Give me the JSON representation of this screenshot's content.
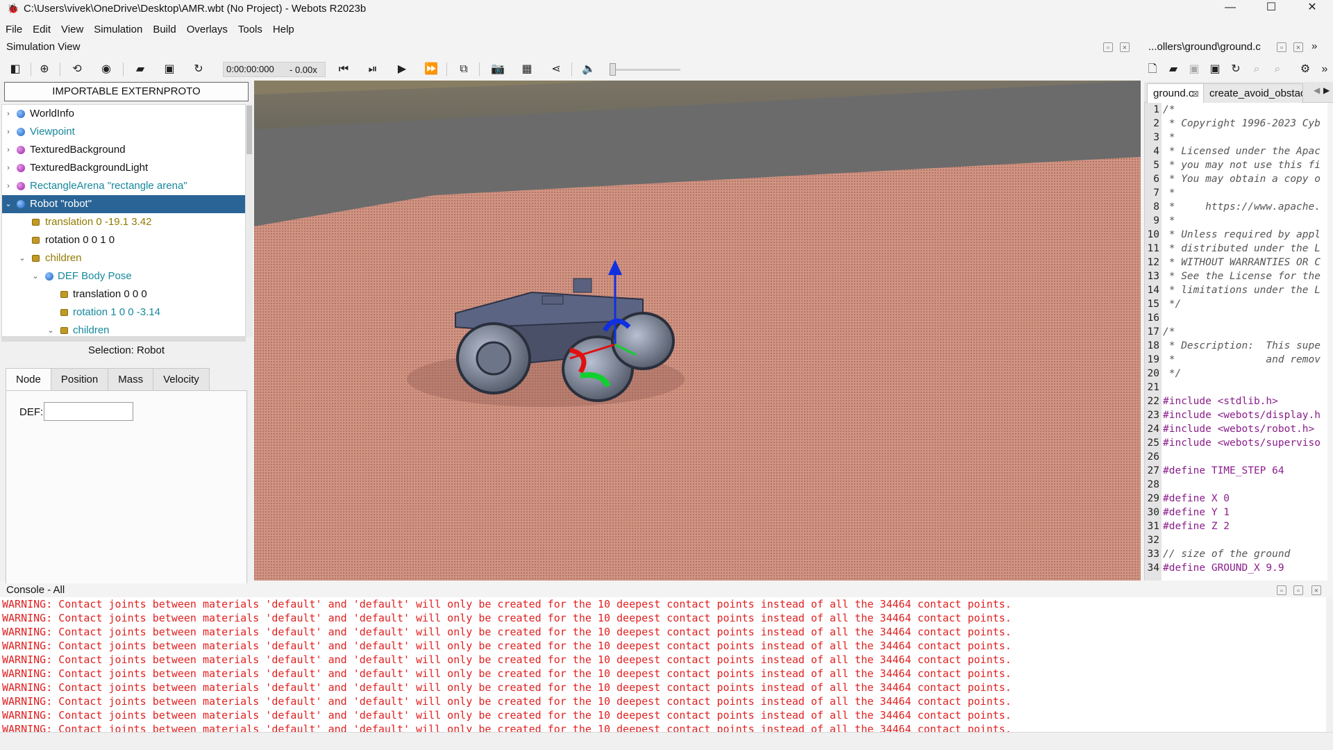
{
  "window": {
    "title": "C:\\Users\\vivek\\OneDrive\\Desktop\\AMR.wbt (No Project) - Webots R2023b",
    "minimize": "—",
    "maximize": "☐",
    "close": "✕"
  },
  "menu": [
    "File",
    "Edit",
    "View",
    "Simulation",
    "Build",
    "Overlays",
    "Tools",
    "Help"
  ],
  "sim_view": {
    "label": "Simulation View",
    "clock": "0:00:00:000",
    "speed": "- 0.00x"
  },
  "scene_tree": {
    "externproto_button": "IMPORTABLE EXTERNPROTO",
    "rows": [
      {
        "label": "WorldInfo"
      },
      {
        "label": "Viewpoint"
      },
      {
        "label": "TexturedBackground"
      },
      {
        "label": "TexturedBackgroundLight"
      },
      {
        "label": "RectangleArena \"rectangle arena\""
      },
      {
        "label": "Robot \"robot\""
      },
      {
        "label": "translation 0 -19.1 3.42"
      },
      {
        "label": "rotation 0 0 1 0"
      },
      {
        "label": "children"
      },
      {
        "label": "DEF Body Pose"
      },
      {
        "label": "translation 0 0 0"
      },
      {
        "label": "rotation 1 0 0 -3.14"
      },
      {
        "label": "children"
      }
    ]
  },
  "node_editor": {
    "selection": "Selection: Robot",
    "tabs": [
      "Node",
      "Position",
      "Mass",
      "Velocity"
    ],
    "def_label": "DEF:",
    "def_value": ""
  },
  "editor": {
    "title": "...ollers\\ground\\ground.c",
    "tabs": [
      "ground.c",
      "create_avoid_obstac"
    ],
    "lines": [
      {
        "n": "1",
        "text": "/*"
      },
      {
        "n": "2",
        "text": " * Copyright 1996-2023 Cyb"
      },
      {
        "n": "3",
        "text": " *"
      },
      {
        "n": "4",
        "text": " * Licensed under the Apac"
      },
      {
        "n": "5",
        "text": " * you may not use this fi"
      },
      {
        "n": "6",
        "text": " * You may obtain a copy o"
      },
      {
        "n": "7",
        "text": " *"
      },
      {
        "n": "8",
        "text": " *     https://www.apache."
      },
      {
        "n": "9",
        "text": " *"
      },
      {
        "n": "10",
        "text": " * Unless required by appl"
      },
      {
        "n": "11",
        "text": " * distributed under the L"
      },
      {
        "n": "12",
        "text": " * WITHOUT WARRANTIES OR C"
      },
      {
        "n": "13",
        "text": " * See the License for the"
      },
      {
        "n": "14",
        "text": " * limitations under the L"
      },
      {
        "n": "15",
        "text": " */"
      },
      {
        "n": "16",
        "text": ""
      },
      {
        "n": "17",
        "text": "/*"
      },
      {
        "n": "18",
        "text": " * Description:  This supe"
      },
      {
        "n": "19",
        "text": " *               and remov"
      },
      {
        "n": "20",
        "text": " */"
      },
      {
        "n": "21",
        "text": ""
      },
      {
        "n": "22",
        "text": "#include <stdlib.h>"
      },
      {
        "n": "23",
        "text": "#include <webots/display.h"
      },
      {
        "n": "24",
        "text": "#include <webots/robot.h>"
      },
      {
        "n": "25",
        "text": "#include <webots/superviso"
      },
      {
        "n": "26",
        "text": ""
      },
      {
        "n": "27",
        "text": "#define TIME_STEP 64"
      },
      {
        "n": "28",
        "text": ""
      },
      {
        "n": "29",
        "text": "#define X 0"
      },
      {
        "n": "30",
        "text": "#define Y 1"
      },
      {
        "n": "31",
        "text": "#define Z 2"
      },
      {
        "n": "32",
        "text": ""
      },
      {
        "n": "33",
        "text": "// size of the ground"
      },
      {
        "n": "34",
        "text": "#define GROUND_X 9.9"
      }
    ]
  },
  "console": {
    "title": "Console - All",
    "lines": [
      "WARNING: Contact joints between materials 'default' and 'default' will only be created for the 10 deepest contact points instead of all the 34464 contact points.",
      "WARNING: Contact joints between materials 'default' and 'default' will only be created for the 10 deepest contact points instead of all the 34464 contact points.",
      "WARNING: Contact joints between materials 'default' and 'default' will only be created for the 10 deepest contact points instead of all the 34464 contact points.",
      "WARNING: Contact joints between materials 'default' and 'default' will only be created for the 10 deepest contact points instead of all the 34464 contact points.",
      "WARNING: Contact joints between materials 'default' and 'default' will only be created for the 10 deepest contact points instead of all the 34464 contact points.",
      "WARNING: Contact joints between materials 'default' and 'default' will only be created for the 10 deepest contact points instead of all the 34464 contact points.",
      "WARNING: Contact joints between materials 'default' and 'default' will only be created for the 10 deepest contact points instead of all the 34464 contact points.",
      "WARNING: Contact joints between materials 'default' and 'default' will only be created for the 10 deepest contact points instead of all the 34464 contact points.",
      "WARNING: Contact joints between materials 'default' and 'default' will only be created for the 10 deepest contact points instead of all the 34464 contact points.",
      "WARNING: Contact joints between materials 'default' and 'default' will only be created for the 10 deepest contact points instead of all the 34464 contact points."
    ]
  },
  "colors": {
    "selection": "#2a6496",
    "warning_text": "#e02020",
    "field_link": "#16889c",
    "floor": "#c98a7c"
  }
}
